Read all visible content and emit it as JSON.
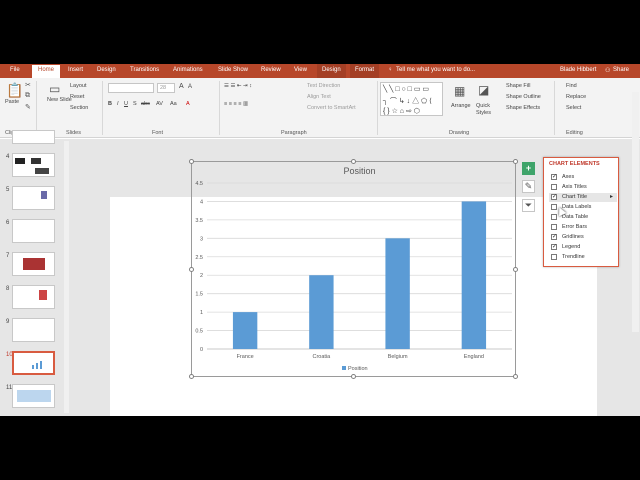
{
  "tabs": [
    "File",
    "Home",
    "Insert",
    "Design",
    "Transitions",
    "Animations",
    "Slide Show",
    "Review",
    "View",
    "Design",
    "Format"
  ],
  "active_tab": "Home",
  "tell_me": "Tell me what you want to do...",
  "user": "Blade Hibbert",
  "share": "Share",
  "ribbon": {
    "paste": "Paste",
    "new_slide": "New Slide",
    "layout": "Layout",
    "reset": "Reset",
    "section": "Section",
    "font_size": "28",
    "text_direction": "Text Direction",
    "align_text": "Align Text",
    "convert_smartart": "Convert to SmartArt",
    "arrange": "Arrange",
    "quick_styles": "Quick Styles",
    "shape_fill": "Shape Fill",
    "shape_outline": "Shape Outline",
    "shape_effects": "Shape Effects",
    "find": "Find",
    "replace": "Replace",
    "select": "Select",
    "groups": [
      "Clipboard",
      "Slides",
      "Font",
      "Paragraph",
      "Drawing",
      "Editing"
    ]
  },
  "slide_numbers": [
    "4",
    "5",
    "6",
    "7",
    "8",
    "9",
    "10",
    "11"
  ],
  "chart_elements": {
    "header": "CHART ELEMENTS",
    "items": [
      {
        "label": "Axes",
        "checked": true
      },
      {
        "label": "Axis Titles",
        "checked": false
      },
      {
        "label": "Chart Title",
        "checked": true
      },
      {
        "label": "Data Labels",
        "checked": false
      },
      {
        "label": "Data Table",
        "checked": false
      },
      {
        "label": "Error Bars",
        "checked": false
      },
      {
        "label": "Gridlines",
        "checked": true
      },
      {
        "label": "Legend",
        "checked": true
      },
      {
        "label": "Trendline",
        "checked": false
      }
    ]
  },
  "chart_data": {
    "type": "bar",
    "title": "Position",
    "categories": [
      "France",
      "Croatia",
      "Belgium",
      "England"
    ],
    "series": [
      {
        "name": "Position",
        "values": [
          1,
          2,
          3,
          4
        ]
      }
    ],
    "ylim": [
      0,
      4.5
    ],
    "yticks": [
      "0",
      "0.5",
      "1",
      "1.5",
      "2",
      "2.5",
      "3",
      "3.5",
      "4",
      "4.5"
    ],
    "grid": true,
    "legend": "bottom",
    "color": "#5b9bd5"
  }
}
